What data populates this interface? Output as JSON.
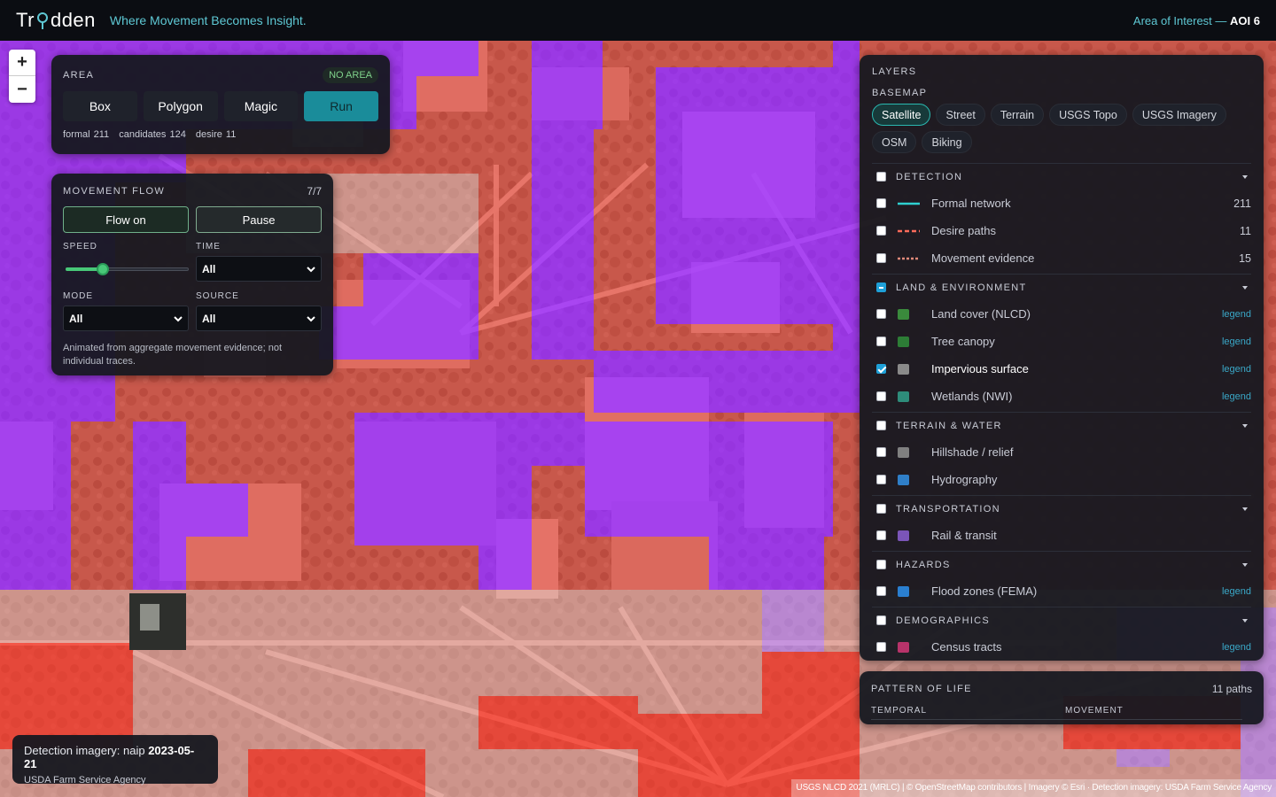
{
  "header": {
    "brand": "Trodden",
    "brand_left": "Tr",
    "brand_right": "dden",
    "tagline": "Where Movement Becomes Insight.",
    "aoi_prefix": "Area of Interest —",
    "aoi_value": "AOI 6"
  },
  "zoom": {
    "in": "+",
    "out": "−"
  },
  "area": {
    "title": "AREA",
    "badge": "NO AREA",
    "buttons": [
      "Box",
      "Polygon",
      "Magic",
      "Run"
    ],
    "stats": [
      "formal 211",
      "candidates 124",
      "desire 11"
    ]
  },
  "flow": {
    "title": "MOVEMENT FLOW",
    "count": "7/7",
    "flow_on": "Flow on",
    "pause": "Pause",
    "speed_label": "SPEED",
    "speed_fraction": 0.3,
    "time_label": "TIME",
    "time_value": "All",
    "mode_label": "MODE",
    "mode_value": "All",
    "source_label": "SOURCE",
    "source_value": "All",
    "note": "Animated from aggregate movement evidence; not individual traces."
  },
  "layers": {
    "title": "LAYERS",
    "basemap_label": "BASEMAP",
    "basemaps": [
      "Satellite",
      "Street",
      "Terrain",
      "USGS Topo",
      "USGS Imagery",
      "OSM",
      "Biking"
    ],
    "active_basemap": "Satellite",
    "groups": {
      "detection": {
        "title": "DETECTION",
        "rows": [
          {
            "name": "Formal network",
            "value": "211",
            "color": "#2fd0d0"
          },
          {
            "name": "Desire paths",
            "value": "11",
            "color": "#ff6b5a"
          },
          {
            "name": "Movement evidence",
            "value": "15",
            "color": "#e08a7a"
          }
        ]
      },
      "land": {
        "title": "LAND & ENVIRONMENT",
        "rows": [
          {
            "name": "Land cover (NLCD)",
            "legend": "legend",
            "color": "#3a8a3c"
          },
          {
            "name": "Tree canopy",
            "legend": "legend",
            "color": "#2d7d36"
          },
          {
            "name": "Impervious surface",
            "legend": "legend",
            "color": "#8a8a8a"
          },
          {
            "name": "Wetlands (NWI)",
            "legend": "legend",
            "color": "#2e8c7a"
          }
        ]
      },
      "terrain": {
        "title": "TERRAIN & WATER",
        "rows": [
          {
            "name": "Hillshade / relief",
            "color": "#808080"
          },
          {
            "name": "Hydrography",
            "color": "#2f7fc8"
          }
        ]
      },
      "transport": {
        "title": "TRANSPORTATION",
        "rows": [
          {
            "name": "Rail & transit",
            "color": "#7b55b8"
          }
        ]
      },
      "hazards": {
        "title": "HAZARDS",
        "rows": [
          {
            "name": "Flood zones (FEMA)",
            "legend": "legend",
            "color": "#2a7fd0"
          }
        ]
      },
      "demo": {
        "title": "DEMOGRAPHICS",
        "rows": [
          {
            "name": "Census tracts",
            "legend": "legend",
            "color": "#b8336a"
          }
        ]
      }
    }
  },
  "pattern": {
    "title": "PATTERN OF LIFE",
    "count": "11 paths",
    "col1": "TEMPORAL",
    "col2": "MOVEMENT"
  },
  "imagery": {
    "prefix": "Detection imagery: naip",
    "date": "2023-05-21",
    "agency": "USDA Farm Service Agency"
  },
  "attribution": "USGS NLCD 2021 (MRLC) | © OpenStreetMap contributors | Imagery © Esri · Detection imagery: USDA Farm Service Agency"
}
